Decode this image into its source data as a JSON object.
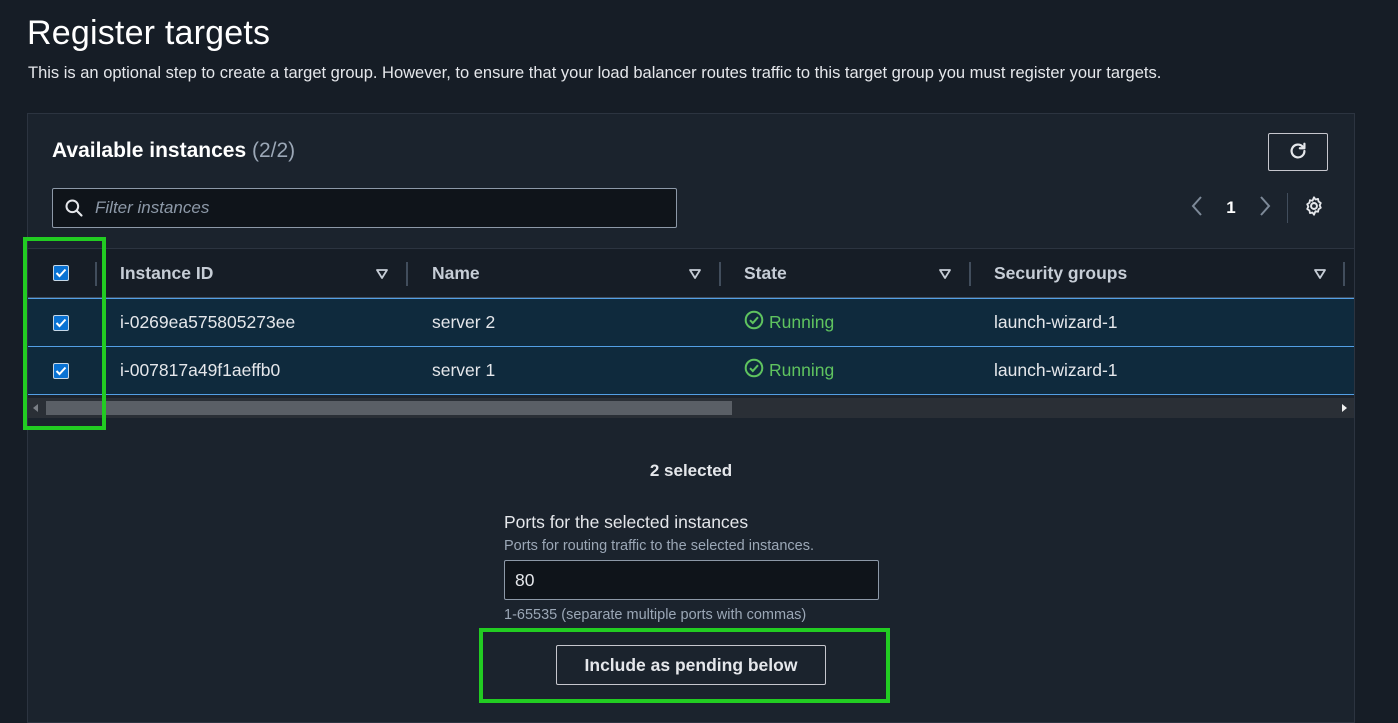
{
  "page": {
    "title": "Register targets",
    "description": "This is an optional step to create a target group. However, to ensure that your load balancer routes traffic to this target group you must register your targets."
  },
  "panel": {
    "title": "Available instances",
    "count": "(2/2)",
    "refresh_icon": "refresh-icon",
    "search": {
      "placeholder": "Filter instances",
      "value": ""
    },
    "pagination": {
      "current_page": "1",
      "settings_icon": "gear-icon"
    }
  },
  "table": {
    "columns": [
      "Instance ID",
      "Name",
      "State",
      "Security groups"
    ],
    "select_all_checked": true,
    "rows": [
      {
        "checked": true,
        "instance_id": "i-0269ea575805273ee",
        "name": "server 2",
        "state": "Running",
        "security_groups": "launch-wizard-1"
      },
      {
        "checked": true,
        "instance_id": "i-007817a49f1aeffb0",
        "name": "server 1",
        "state": "Running",
        "security_groups": "launch-wizard-1"
      }
    ]
  },
  "selection": {
    "summary": "2 selected"
  },
  "ports": {
    "label": "Ports for the selected instances",
    "description": "Ports for routing traffic to the selected instances.",
    "value": "80",
    "hint": "1-65535 (separate multiple ports with commas)"
  },
  "actions": {
    "include_label": "Include as pending below"
  },
  "colors": {
    "background": "#161d26",
    "panel": "#1b232d",
    "selected_row": "#0f2a3d",
    "selected_border": "#539fe5",
    "checkbox": "#0972d3",
    "running": "#5fc35f",
    "highlight": "#22cc22"
  }
}
